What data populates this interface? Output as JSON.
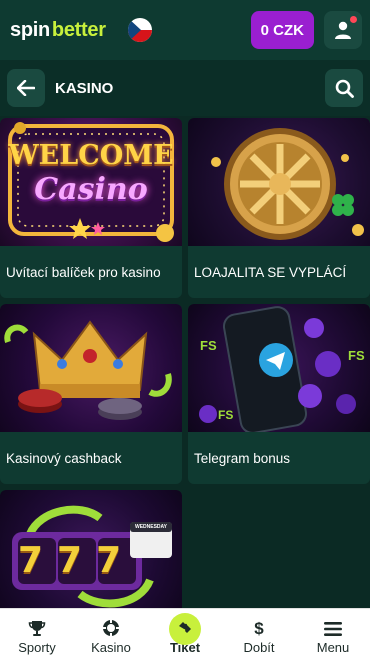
{
  "header": {
    "logo_spin": "spin",
    "logo_better": "better",
    "balance": "0 CZK"
  },
  "subheader": {
    "title": "KASINO"
  },
  "cards": [
    {
      "label": "Uvítací balíček pro kasino",
      "image_text_line1": "WELCOME",
      "image_text_line2": "Casino"
    },
    {
      "label": "LOAJALITA SE VYPLÁCÍ"
    },
    {
      "label": "Kasinový cashback"
    },
    {
      "label": "Telegram bonus",
      "image_badge": "FS"
    },
    {
      "label": "",
      "image_text": "777",
      "image_calendar": "WEDNESDAY"
    }
  ],
  "bottom_nav": [
    {
      "label": "Sporty",
      "icon": "trophy-icon"
    },
    {
      "label": "Kasino",
      "icon": "casino-chip-icon"
    },
    {
      "label": "Tiket",
      "icon": "ticket-icon"
    },
    {
      "label": "Dobít",
      "icon": "dollar-icon"
    },
    {
      "label": "Menu",
      "icon": "menu-icon"
    }
  ],
  "colors": {
    "brand_green": "#c8f03c",
    "balance_purple": "#9a1fd0",
    "bg_dark": "#0b2a24"
  }
}
